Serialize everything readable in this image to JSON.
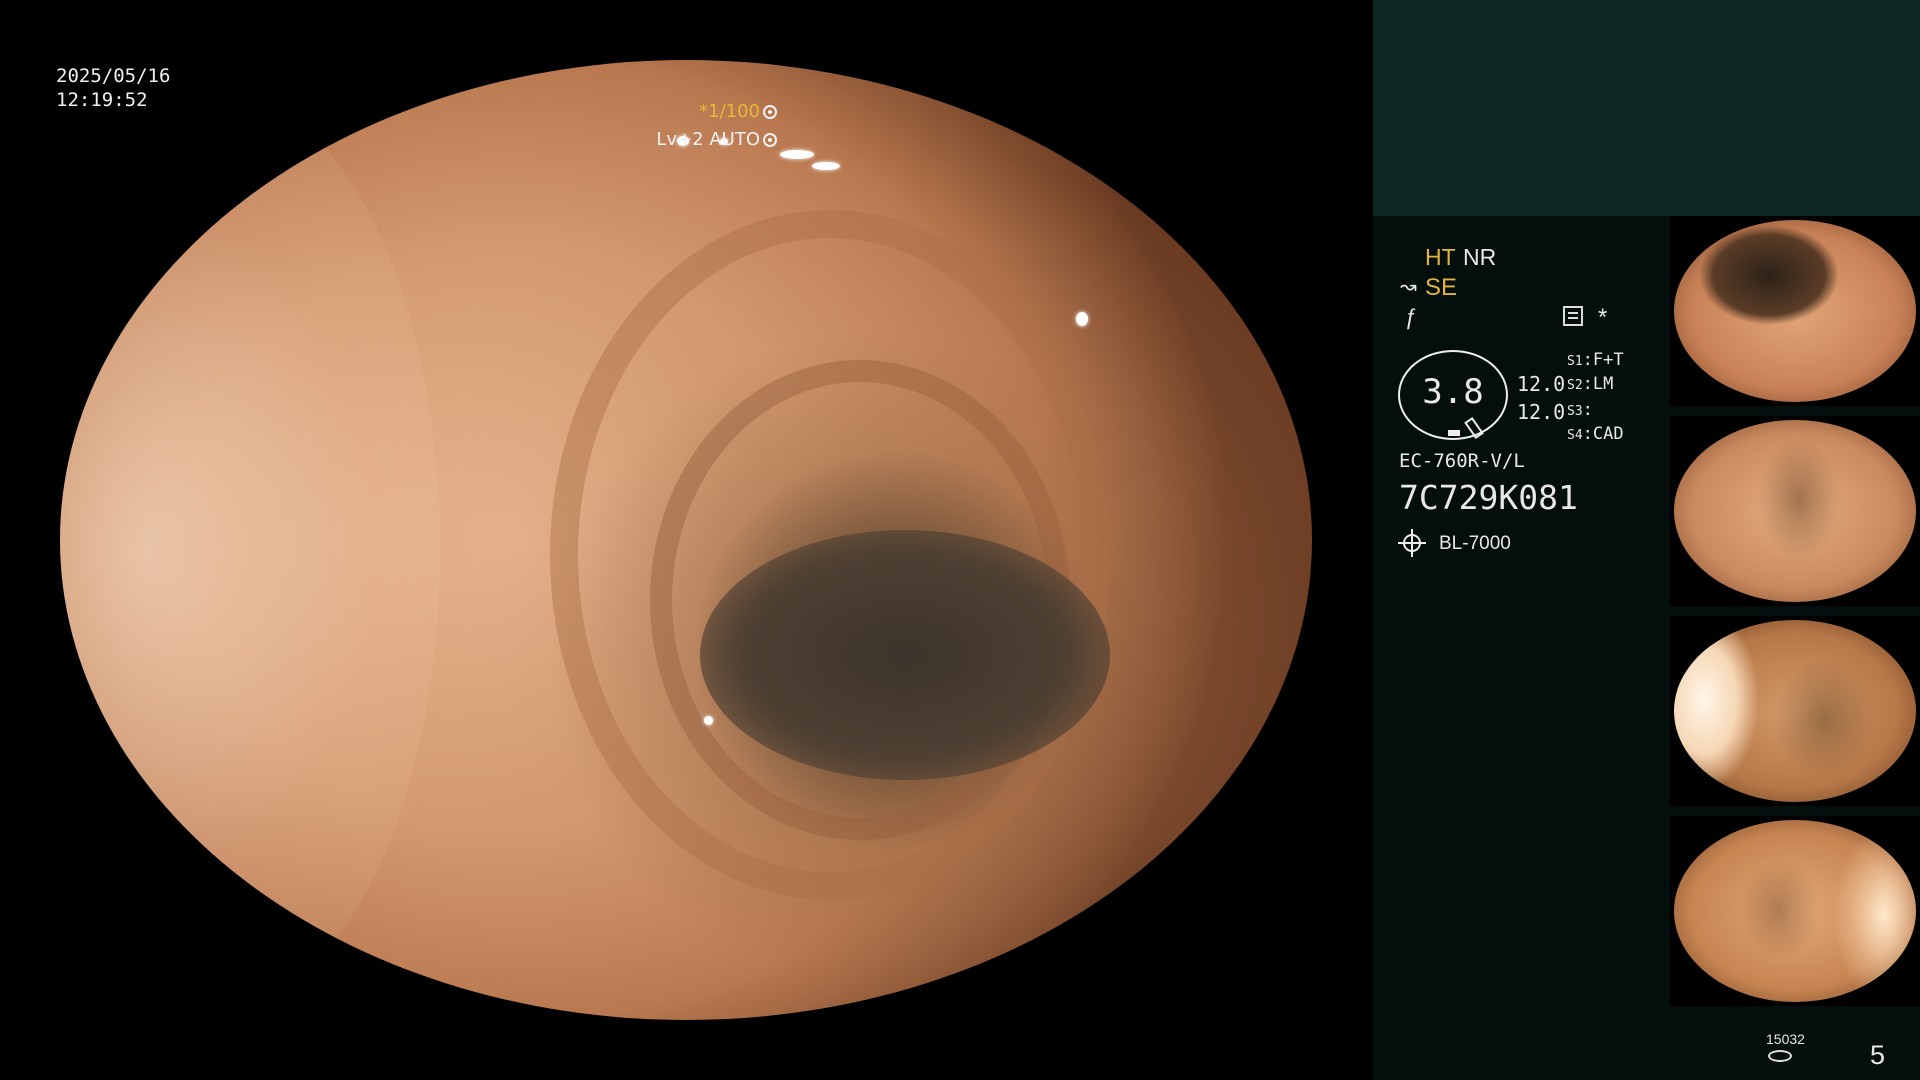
{
  "overlay": {
    "date": "2025/05/16",
    "time": "12:19:52",
    "shutter": "*1/100",
    "level": "Lv+2 AUTO",
    "shutter_icon": "aperture-icon",
    "level_icon": "iris-icon"
  },
  "panel": {
    "ht": "HT",
    "nr": "NR",
    "se_icon": "↝",
    "se": "SE",
    "fx_icon": "ƒ",
    "asterisk": "*",
    "gauge_value": "3.8",
    "value_1": "12.0",
    "value_2": "12.0",
    "switches": [
      {
        "key": "S1",
        "value": "F+T"
      },
      {
        "key": "S2",
        "value": "LM"
      },
      {
        "key": "S3",
        "value": ""
      },
      {
        "key": "S4",
        "value": "CAD"
      }
    ],
    "scope_model": "EC-760R-V/L",
    "scope_serial": "7C729K081",
    "light_source": "BL-7000",
    "counter": "15032",
    "page_number": "5"
  },
  "colors": {
    "panel_bg": "#040e0c",
    "panel_header": "#0d2822",
    "accent_yellow": "#e3b43c"
  }
}
